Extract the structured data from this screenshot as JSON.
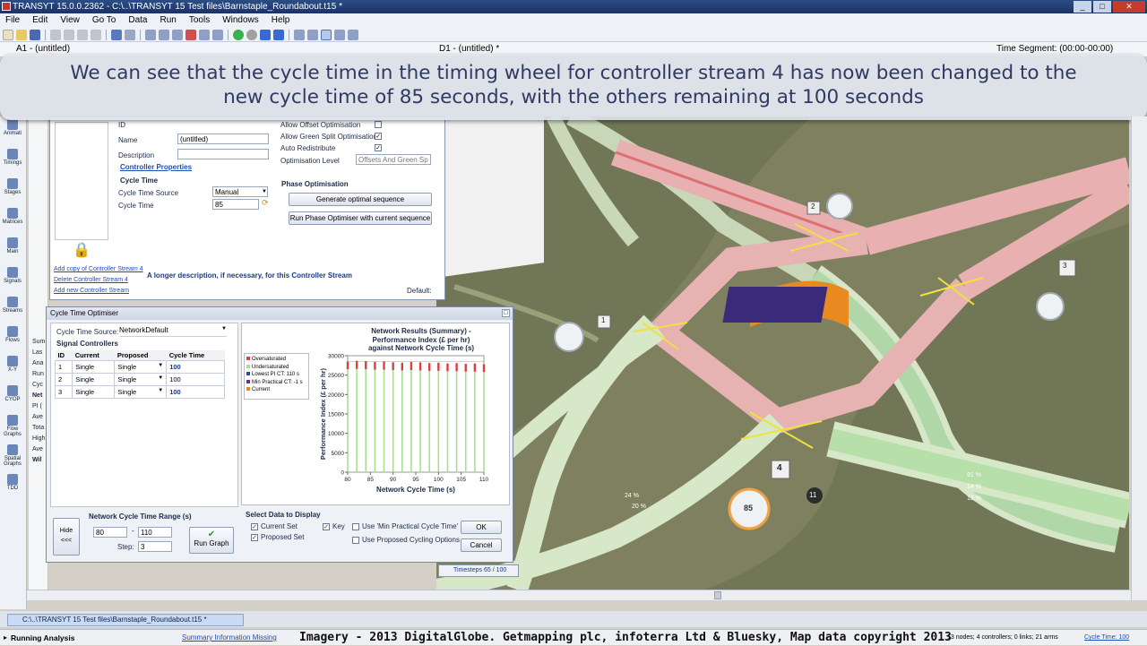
{
  "window": {
    "title": "TRANSYT 15.0.0.2362 - C:\\..\\TRANSYT 15 Test files\\Barnstaple_Roundabout.t15 *",
    "controls": [
      "_",
      "□",
      "✕"
    ]
  },
  "menu": [
    "File",
    "Edit",
    "View",
    "Go To",
    "Data",
    "Run",
    "Tools",
    "Windows",
    "Help"
  ],
  "docbar": {
    "left": "A1 - (untitled)",
    "middle": "D1 - (untitled) *",
    "right": "Time Segment: (00:00-00:00)"
  },
  "banner": {
    "line1": "We can see that the cycle time in the timing wheel for controller stream 4 has now been changed to the",
    "line2": "new cycle time of 85 seconds, with the others remaining at 100 seconds"
  },
  "leftstrip": [
    "Animati",
    "Timings",
    "Stages",
    "Matrices",
    "Main",
    "Signals",
    "Streams",
    "Flows",
    "X-Y",
    "CYOP",
    "Flow Graphs",
    "Spatial Graphs",
    "TDD"
  ],
  "controller": {
    "id_label": "ID",
    "name_label": "Name",
    "name_value": "(untitled)",
    "description_label": "Description",
    "description_value": "",
    "properties_link": "Controller Properties",
    "cycle_heading": "Cycle Time",
    "cycle_source_label": "Cycle Time Source",
    "cycle_source_value": "Manual",
    "cycle_time_label": "Cycle Time",
    "cycle_time_value": "85",
    "offset_opt_label": "Allow Offset Optimisation",
    "green_split_label": "Allow Green Split Optimisation",
    "auto_redistribute_label": "Auto Redistribute",
    "opt_level_label": "Optimisation Level",
    "opt_level_value": "Offsets And Green Sp",
    "phase_heading": "Phase Optimisation",
    "gen_seq_button": "Generate optimal sequence",
    "run_phase_button": "Run Phase Optimiser with current sequence",
    "links": [
      "Add copy of Controller Stream 4",
      "Delete Controller Stream 4",
      "Add new Controller Stream"
    ],
    "long_desc": "A longer description, if necessary, for this Controller Stream",
    "default_label": "Default:"
  },
  "side_texts": [
    "Sum",
    "Las",
    "Ana",
    "Run",
    "Cyc",
    "Net",
    "PI (",
    "Ave",
    "Tota",
    "High",
    "Ave",
    "Wil"
  ],
  "optimiser": {
    "title": "Cycle Time Optimiser",
    "source_label": "Cycle Time Source:",
    "source_value": "NetworkDefault",
    "group_label": "Signal Controllers",
    "columns": [
      "ID",
      "Current",
      "Proposed",
      "Cycle Time"
    ],
    "rows": [
      {
        "id": "1",
        "current": "Single",
        "proposed": "Single",
        "cycle": "100"
      },
      {
        "id": "2",
        "current": "Single",
        "proposed": "Single",
        "cycle": "100"
      },
      {
        "id": "3",
        "current": "Single",
        "proposed": "Single",
        "cycle": "100"
      }
    ],
    "hide_label": "Hide <<<",
    "range_label": "Network Cycle Time Range (s)",
    "range_from": "80",
    "range_to": "110",
    "step_label": "Step:",
    "step_value": "3",
    "run_graph": "Run Graph",
    "select_label": "Select Data to Display",
    "current_set": "Current Set",
    "proposed_set": "Proposed Set",
    "key_label": "Key",
    "use_min_practical": "Use 'Min Practical Cycle Time'",
    "use_proposed": "Use Proposed Cycling Options",
    "ok": "OK",
    "cancel": "Cancel"
  },
  "chart_data": {
    "type": "bar",
    "title": "Network Results (Summary) - Performance Index (£ per hr) against Network Cycle Time (s)",
    "title_lines": [
      "Network Results (Summary) -",
      "Performance Index (£ per hr)",
      "against Network Cycle Time (s)"
    ],
    "xlabel": "Network Cycle Time (s)",
    "ylabel": "Performance Index (£ per hr)",
    "x": [
      80,
      82,
      84,
      86,
      88,
      90,
      92,
      94,
      96,
      98,
      100,
      102,
      104,
      106,
      108,
      110
    ],
    "oversaturated": [
      28500,
      28700,
      28600,
      28400,
      28500,
      28300,
      28200,
      28400,
      28300,
      28100,
      28200,
      28000,
      28100,
      27900,
      28000,
      27800
    ],
    "undersaturated": [
      26500,
      26600,
      26500,
      26400,
      26400,
      26300,
      26200,
      26300,
      26200,
      26100,
      26100,
      26000,
      26000,
      25900,
      25900,
      25800
    ],
    "xlim": [
      80,
      110
    ],
    "ylim": [
      0,
      30000
    ],
    "xticks": [
      "80",
      "85",
      "90",
      "95",
      "100",
      "105",
      "110"
    ],
    "yticks": [
      "0",
      "5000",
      "10000",
      "15000",
      "20000",
      "25000",
      "30000"
    ],
    "legend": [
      "Oversaturated",
      "Undersaturated",
      "Lowest PI CT: 110 s",
      "Min Practical CT: -1 s",
      "Current"
    ],
    "legend_placement": "left",
    "colors": {
      "over": "#d94040",
      "under": "#a8e090",
      "lowest": "#2a4aa0",
      "minprac": "#7a2a8a",
      "current": "#e08a20"
    }
  },
  "map": {
    "timesteps": "Timesteps 65 / 100",
    "wheel_value": "85",
    "node_labels": [
      "1",
      "2",
      "3",
      "4",
      "11"
    ],
    "lane_labels": [
      "91 %",
      "14 %",
      "13 %",
      "24 %",
      "20 %"
    ]
  },
  "tab": {
    "label": "C:\\..\\TRANSYT 15 Test files\\Barnstaple_Roundabout.t15 *"
  },
  "status": {
    "left": "Running Analysis",
    "missing": "Summary Information Missing",
    "credit": "Imagery - 2013 DigitalGlobe. Getmapping plc, infoterra Ltd & Bluesky, Map data copyright 2013",
    "counts": "13 nodes; 4 controllers; 0 links; 21 arms",
    "cycle": "Cycle Time: 100"
  }
}
